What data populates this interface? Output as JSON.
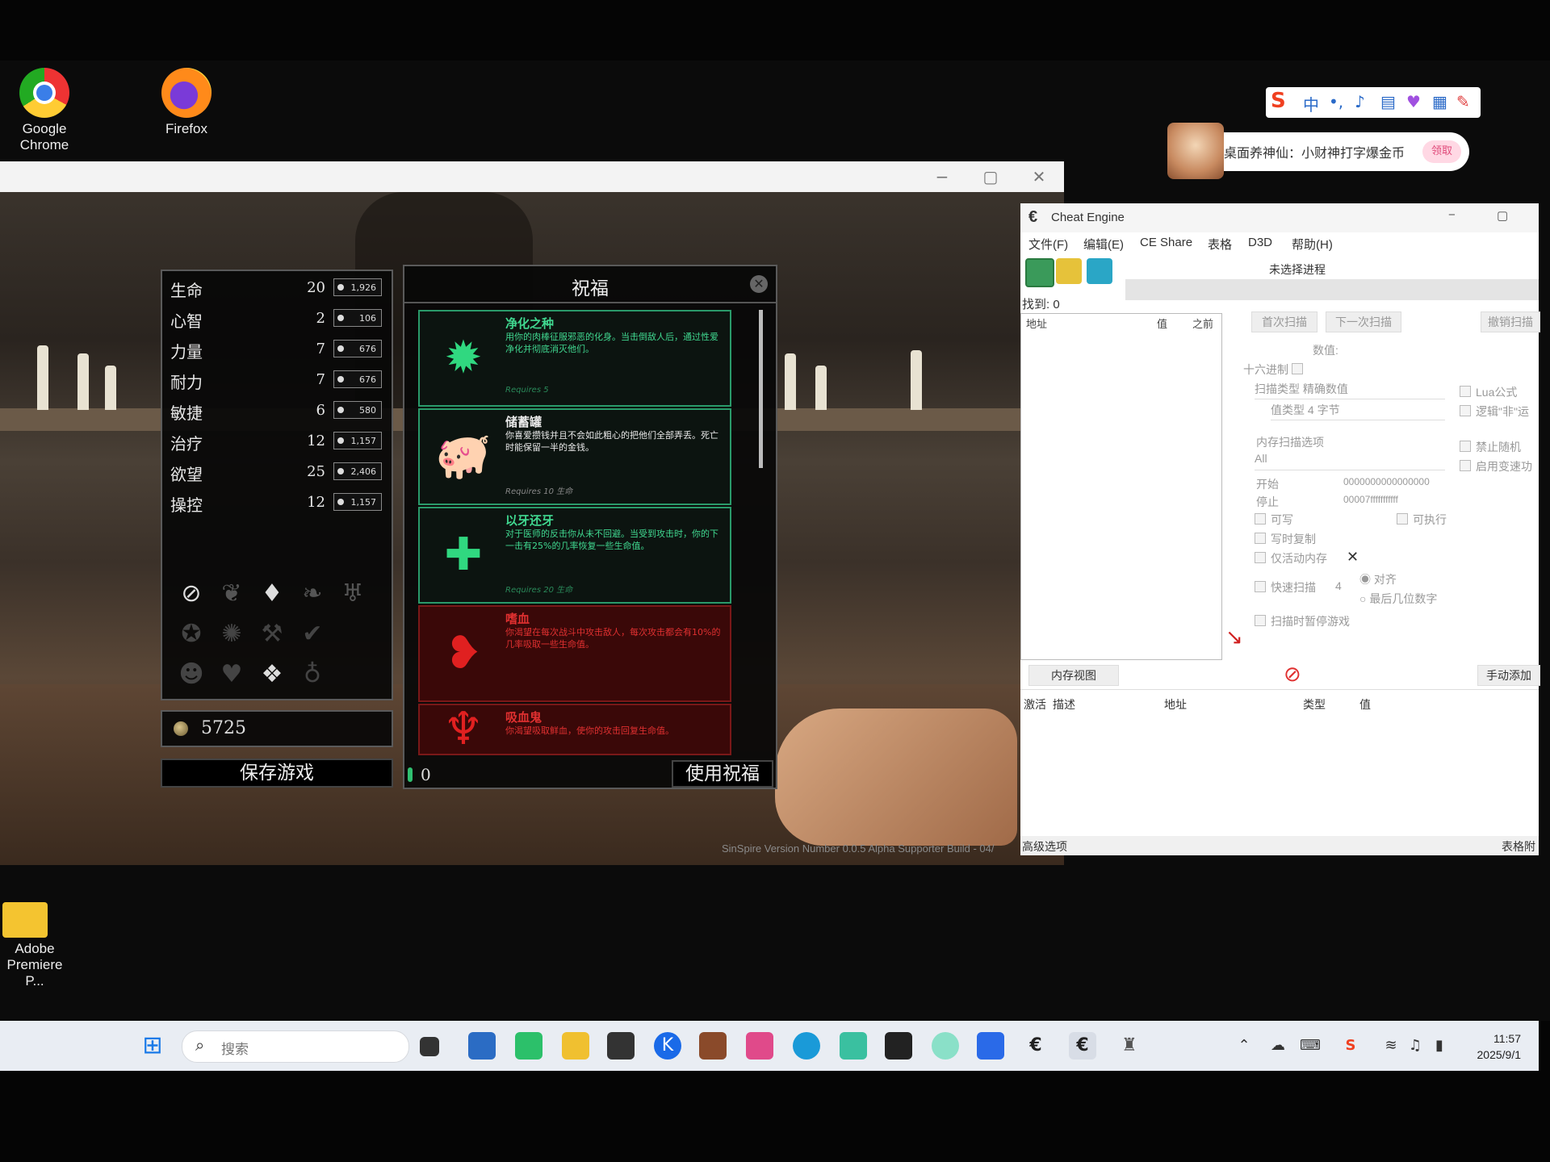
{
  "desktop": {
    "icons": [
      {
        "label": "Google\nChrome"
      },
      {
        "label": "Firefox"
      },
      {
        "label": "Adobe\nPremiere P..."
      }
    ]
  },
  "game": {
    "stats": [
      {
        "name": "生命",
        "level": "20",
        "cost": "1,926"
      },
      {
        "name": "心智",
        "level": "2",
        "cost": "106"
      },
      {
        "name": "力量",
        "level": "7",
        "cost": "676"
      },
      {
        "name": "耐力",
        "level": "7",
        "cost": "676"
      },
      {
        "name": "敏捷",
        "level": "6",
        "cost": "580"
      },
      {
        "name": "治疗",
        "level": "12",
        "cost": "1,157"
      },
      {
        "name": "欲望",
        "level": "25",
        "cost": "2,406"
      },
      {
        "name": "操控",
        "level": "12",
        "cost": "1,157"
      }
    ],
    "gold": "5725",
    "save_label": "保存游戏",
    "bless_title": "祝福",
    "essence": "0",
    "use_label": "使用祝福",
    "version": "SinSpire Version Number 0.0.5 Alpha Supporter Build - 04/",
    "blessings": [
      {
        "title": "净化之种",
        "desc": "用你的肉棒征服邪恶的化身。当击倒敌人后，通过性爱净化并彻底消灭他们。",
        "req": "Requires 5",
        "color": "green"
      },
      {
        "title": "储蓄罐",
        "desc": "你喜爱攒钱并且不会如此粗心的把他们全部弄丢。死亡时能保留一半的金钱。",
        "req": "Requires 10 生命",
        "color": "white"
      },
      {
        "title": "以牙还牙",
        "desc": "对于医师的反击你从未不回避。当受到攻击时，你的下一击有25%的几率恢复一些生命值。",
        "req": "Requires 20 生命",
        "color": "green"
      },
      {
        "title": "嗜血",
        "desc": "你渴望在每次战斗中攻击敌人，每次攻击都会有10%的几率吸取一些生命值。",
        "req": "",
        "color": "red"
      },
      {
        "title": "吸血鬼",
        "desc": "你渴望吸取鲜血，使你的攻击回复生命值。",
        "req": "",
        "color": "red"
      }
    ]
  },
  "ce": {
    "title": "Cheat Engine",
    "menu": [
      "文件(F)",
      "编辑(E)",
      "CE Share",
      "表格",
      "D3D",
      "帮助(H)"
    ],
    "process": "未选择进程",
    "found": "找到: 0",
    "cols": {
      "addr": "地址",
      "val": "值",
      "prev": "之前"
    },
    "first_scan": "首次扫描",
    "next_scan": "下一次扫描",
    "undo_scan": "撤销扫描",
    "value_label": "数值:",
    "hex": "十六进制",
    "scan_type": "扫描类型  精确数值",
    "value_type": "值类型  4 字节",
    "lua": "Lua公式",
    "logic": "逻辑\"非\"运",
    "mem_opts": "内存扫描选项",
    "all": "All",
    "no_random": "禁止随机",
    "speedhack": "启用变速功",
    "start_label": "开始",
    "start_val": "0000000000000000",
    "stop_label": "停止",
    "stop_val": "00007fffffffffff",
    "writable": "可写",
    "executable": "可执行",
    "cow": "写时复制",
    "active_mem": "仅活动内存",
    "fast_scan": "快速扫描",
    "fast_val": "4",
    "align": "对齐",
    "last_digits": "最后几位数字",
    "pause": "扫描时暂停游戏",
    "mem_view": "内存视图",
    "manual_add": "手动添加",
    "tcols": {
      "active": "激活",
      "desc": "描述",
      "addr": "地址",
      "type": "类型",
      "val": "值"
    },
    "advanced": "高级选项",
    "table_extras": "表格附"
  },
  "ime": {
    "notify": "桌面养神仙：小财神打字爆金币",
    "btn": "领取"
  },
  "taskbar": {
    "search": "搜索",
    "time": "11:57",
    "date": "2025/9/1"
  }
}
